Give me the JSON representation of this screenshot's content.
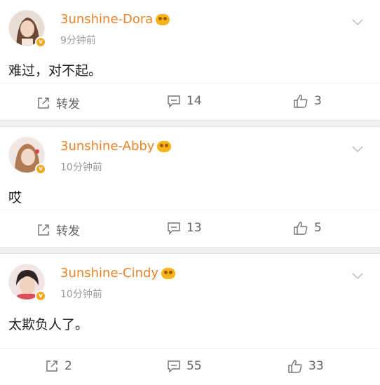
{
  "posts": [
    {
      "username": "3unshine-Dora",
      "time": "9分钟前",
      "content": "难过，对不起。",
      "repost": "转发",
      "comments": "14",
      "likes": "3"
    },
    {
      "username": "3unshine-Abby",
      "time": "10分钟前",
      "content": "哎",
      "repost": "转发",
      "comments": "13",
      "likes": "5"
    },
    {
      "username": "3unshine-Cindy",
      "time": "10分钟前",
      "content": "太欺负人了。",
      "repost": "2",
      "comments": "55",
      "likes": "33"
    }
  ],
  "colors": {
    "username": "#e8832a",
    "meta": "#999999",
    "accent_badge": "#f3a71a"
  }
}
